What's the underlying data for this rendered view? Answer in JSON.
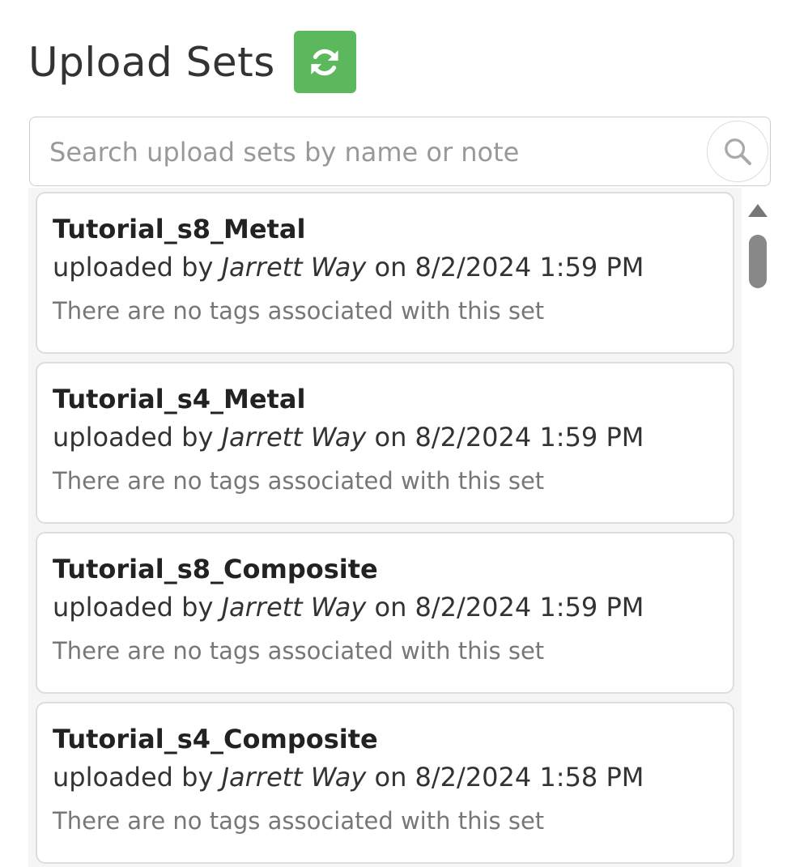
{
  "header": {
    "title": "Upload Sets",
    "refresh_icon": "refresh-icon",
    "refresh_color": "#5cb85c"
  },
  "search": {
    "placeholder": "Search upload sets by name or note",
    "value": "",
    "icon": "search-icon"
  },
  "upload_sets": [
    {
      "name": "Tutorial_s8_Metal",
      "uploaded_prefix": "uploaded by ",
      "user": "Jarrett Way",
      "date_text": " on 8/2/2024 1:59 PM",
      "tags_text": "There are no tags associated with this set"
    },
    {
      "name": "Tutorial_s4_Metal",
      "uploaded_prefix": "uploaded by ",
      "user": "Jarrett Way",
      "date_text": " on 8/2/2024 1:59 PM",
      "tags_text": "There are no tags associated with this set"
    },
    {
      "name": "Tutorial_s8_Composite",
      "uploaded_prefix": "uploaded by ",
      "user": "Jarrett Way",
      "date_text": " on 8/2/2024 1:59 PM",
      "tags_text": "There are no tags associated with this set"
    },
    {
      "name": "Tutorial_s4_Composite",
      "uploaded_prefix": "uploaded by ",
      "user": "Jarrett Way",
      "date_text": " on 8/2/2024 1:58 PM",
      "tags_text": "There are no tags associated with this set"
    }
  ]
}
